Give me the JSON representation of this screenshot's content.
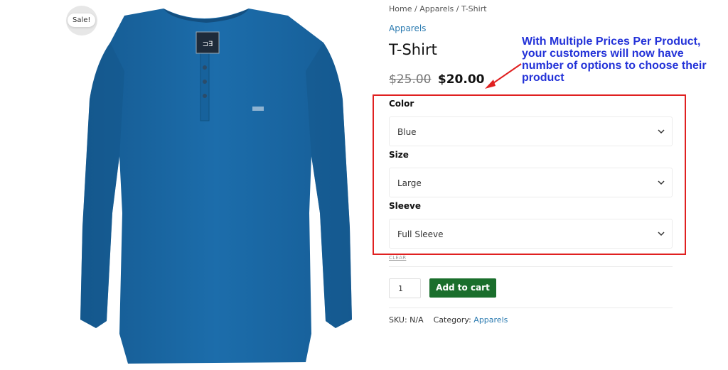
{
  "product": {
    "sale_badge": "Sale!",
    "breadcrumb": [
      "Home",
      "Apparels",
      "T-Shirt"
    ],
    "breadcrumb_sep": "/",
    "category_link": "Apparels",
    "title": "T-Shirt",
    "old_price": "$25.00",
    "new_price": "$20.00",
    "image_icon": "tshirt-image",
    "shirt_color": "#1b6aa6"
  },
  "variations": [
    {
      "label": "Color",
      "value": "Blue"
    },
    {
      "label": "Size",
      "value": "Large"
    },
    {
      "label": "Sleeve",
      "value": "Full Sleeve"
    }
  ],
  "actions": {
    "clear": "CLEAR",
    "quantity": "1",
    "add_to_cart": "Add to cart",
    "add_to_cart_color": "#1a6e2c"
  },
  "meta": {
    "sku_label": "SKU:",
    "sku_value": "N/A",
    "category_label": "Category:",
    "category_value": "Apparels"
  },
  "annotation": {
    "text": "With Multiple Prices Per Product, your customers will now have number of options to choose their product",
    "text_color": "#2332d8",
    "box_color": "#e02020"
  }
}
